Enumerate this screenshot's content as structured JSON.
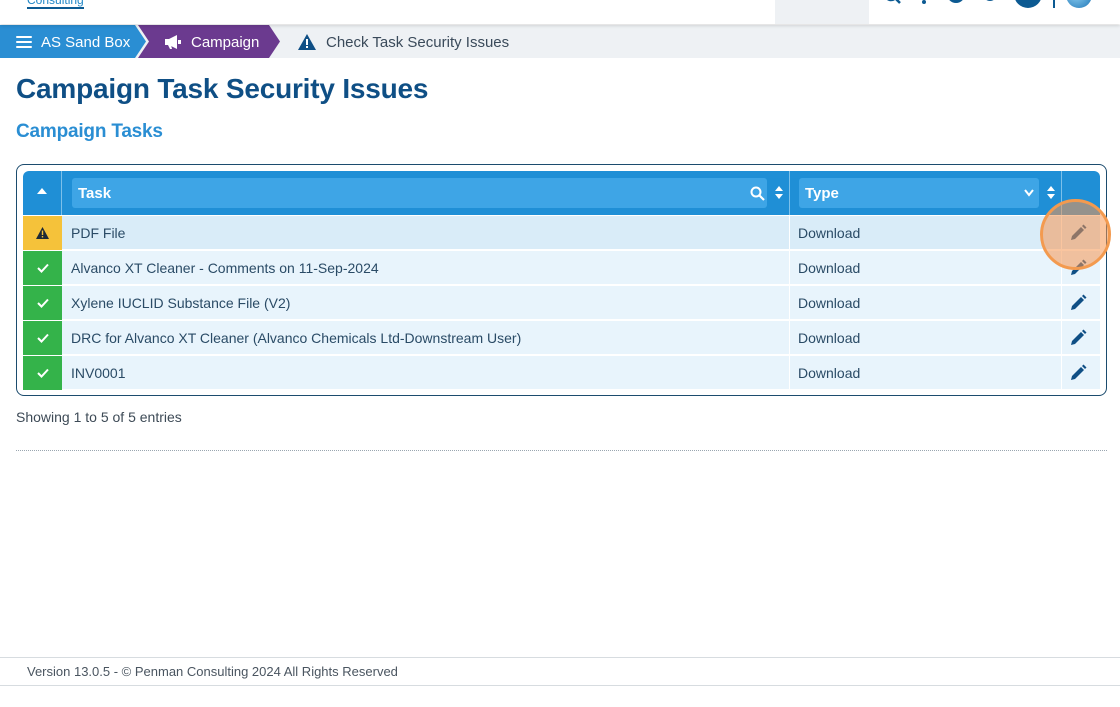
{
  "header": {
    "logo_text": "Consulting"
  },
  "breadcrumb": {
    "root": "AS Sand Box",
    "section": "Campaign",
    "current": "Check Task Security Issues"
  },
  "page": {
    "title": "Campaign Task Security Issues",
    "subtitle": "Campaign Tasks"
  },
  "table": {
    "columns": {
      "task": "Task",
      "type": "Type"
    },
    "rows": [
      {
        "status": "warning",
        "task": "PDF File",
        "type": "Download"
      },
      {
        "status": "ok",
        "task": "Alvanco XT Cleaner - Comments on 11-Sep-2024",
        "type": "Download"
      },
      {
        "status": "ok",
        "task": "Xylene IUCLID Substance File (V2)",
        "type": "Download"
      },
      {
        "status": "ok",
        "task": "DRC for Alvanco XT Cleaner (Alvanco Chemicals Ltd-Downstream User)",
        "type": "Download"
      },
      {
        "status": "ok",
        "task": "INV0001",
        "type": "Download"
      }
    ],
    "entries_info": "Showing 1 to 5 of 5 entries"
  },
  "footer": {
    "text": "Version 13.0.5 - © Penman Consulting 2024 All Rights Reserved"
  },
  "colors": {
    "primary_blue": "#1f8fd6",
    "campaign_purple": "#6b3a8f",
    "title_blue": "#0f4f85",
    "warning": "#f5c23a",
    "ok": "#34b34a",
    "highlight": "#f39a4f"
  }
}
